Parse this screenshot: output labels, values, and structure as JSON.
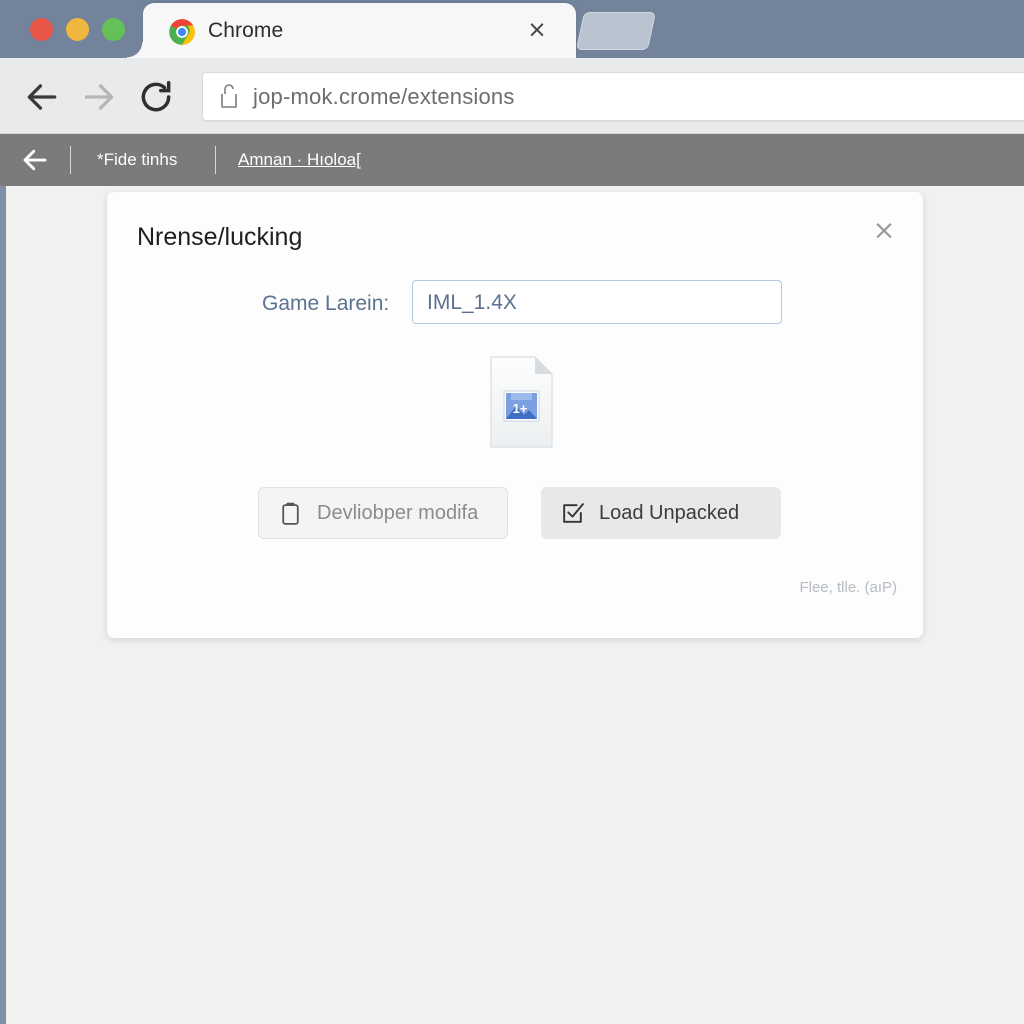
{
  "window": {
    "traffic_lights": [
      "close",
      "minimize",
      "zoom"
    ],
    "colors": {
      "titlebar": "#72839b",
      "toolbar": "#e9eaec",
      "graybar": "#7b7b7b",
      "page_background": "#f1f1f1",
      "dialog_background": "#fdfdfd",
      "accent_label": "#5d7290"
    }
  },
  "tabs": {
    "active": {
      "favicon": "chrome-logo-icon",
      "title": "Chrome",
      "close_label": "×"
    },
    "ghost_tab": "new-tab-placeholder"
  },
  "toolbar": {
    "back_icon": "arrow-left-icon",
    "forward_icon": "arrow-right-icon",
    "reload_icon": "reload-icon",
    "omnibox": {
      "page_icon": "page-info-icon",
      "url": "jop-mok.crome/extensions"
    }
  },
  "graybar": {
    "back_icon": "arrow-left-icon",
    "separator": "|",
    "text": "*Fide tinhs",
    "link": "Amnan · Hıoloa["
  },
  "dialog": {
    "title": "Nrense/lucking",
    "close_label": "×",
    "form": {
      "label": "Game Larein:",
      "value": "IML_1.4X",
      "placeholder": ""
    },
    "file_preview": {
      "icon": "image-file-icon",
      "badge": "1+"
    },
    "buttons": [
      {
        "icon": "clipboard-icon",
        "label": "Devliobper modifa"
      },
      {
        "icon": "checkbox-checked-icon",
        "label": "Load Unpacked"
      }
    ],
    "footer_note": "Flee, tlle. (aıP)"
  }
}
